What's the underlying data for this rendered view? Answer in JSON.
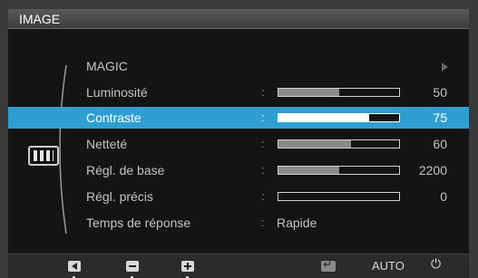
{
  "title": "IMAGE",
  "menu_items": [
    {
      "label": "MAGIC",
      "type": "submenu"
    },
    {
      "label": "Luminosité",
      "type": "slider",
      "value": "50",
      "fill": 0.5
    },
    {
      "label": "Contraste",
      "type": "slider",
      "value": "75",
      "fill": 0.75,
      "selected": true
    },
    {
      "label": "Netteté",
      "type": "slider",
      "value": "60",
      "fill": 0.6
    },
    {
      "label": "Régl. de base",
      "type": "slider",
      "value": "2200",
      "fill": 0.5
    },
    {
      "label": "Régl. précis",
      "type": "slider",
      "value": "0",
      "fill": 0
    },
    {
      "label": "Temps de réponse",
      "type": "text",
      "value": "Rapide"
    }
  ],
  "colon": ":",
  "bottom_buttons": {
    "auto_label": "AUTO",
    "power_symbol": "⏻"
  },
  "colors": {
    "selection": "#2f9ed0",
    "background": "#141414"
  }
}
